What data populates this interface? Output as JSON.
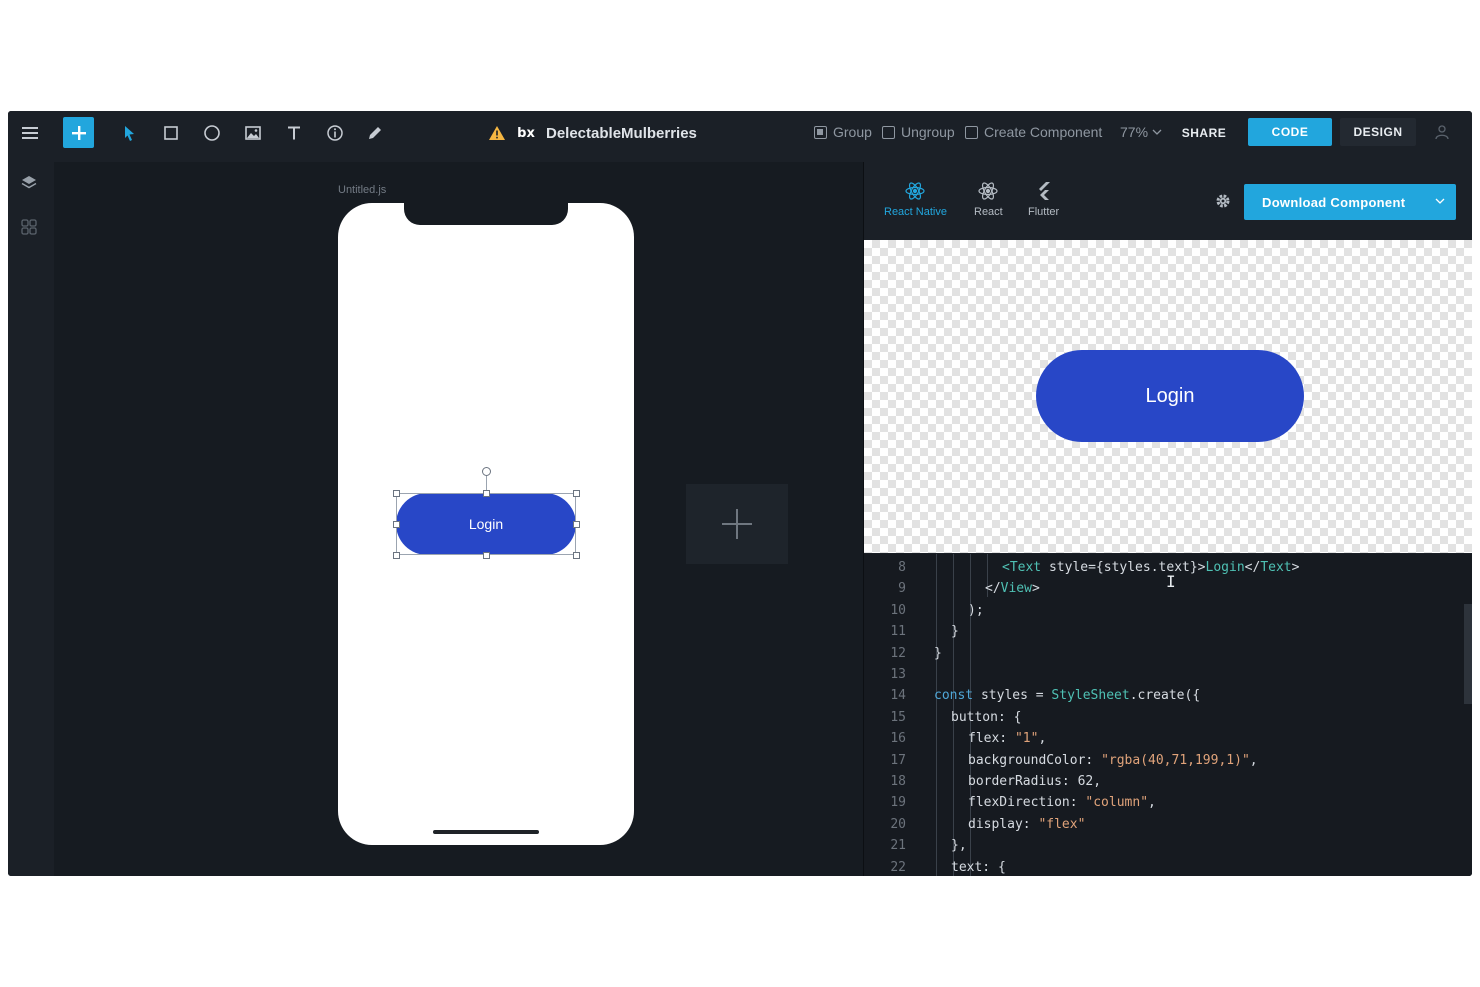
{
  "toolbar": {
    "title": "DelectableMulberries",
    "logo_text": "bx",
    "group_label": "Group",
    "ungroup_label": "Ungroup",
    "create_component_label": "Create Component",
    "zoom": "77%",
    "share_label": "SHARE",
    "code_label": "CODE",
    "design_label": "DESIGN"
  },
  "canvas": {
    "file_name": "Untitled.js",
    "button_label": "Login"
  },
  "panel": {
    "tabs": [
      {
        "label": "React Native",
        "active": true
      },
      {
        "label": "React",
        "active": false
      },
      {
        "label": "Flutter",
        "active": false
      }
    ],
    "download_label": "Download Component",
    "preview_button_label": "Login"
  },
  "code": {
    "lines": [
      {
        "n": "8",
        "indent": 4,
        "html": "<span class='tag'>&lt;Text</span> style={styles.text}&gt;<span class='tag'>Login</span>&lt;/<span class='tag'>Text</span>&gt;",
        "text": "<Text style={styles.text}>Login</Text>"
      },
      {
        "n": "9",
        "indent": 3,
        "html": "&lt;/<span class='tag'>View</span>&gt;",
        "text": "</View>"
      },
      {
        "n": "10",
        "indent": 2,
        "html": ");",
        "text": ");"
      },
      {
        "n": "11",
        "indent": 1,
        "html": "}",
        "text": "}"
      },
      {
        "n": "12",
        "indent": 0,
        "html": "}",
        "text": "}"
      },
      {
        "n": "13",
        "indent": 0,
        "html": "",
        "text": ""
      },
      {
        "n": "14",
        "indent": 0,
        "html": "<span class='kw'>const</span> styles = <span class='cls'>StyleSheet</span>.create({",
        "text": "const styles = StyleSheet.create({"
      },
      {
        "n": "15",
        "indent": 1,
        "html": "button: {",
        "text": "button: {"
      },
      {
        "n": "16",
        "indent": 2,
        "html": "flex: <span class='str'>\"1\"</span>,",
        "text": "flex: \"1\","
      },
      {
        "n": "17",
        "indent": 2,
        "html": "backgroundColor: <span class='str'>\"rgba(40,71,199,1)\"</span>,",
        "text": "backgroundColor: \"rgba(40,71,199,1)\","
      },
      {
        "n": "18",
        "indent": 2,
        "html": "borderRadius: 62,",
        "text": "borderRadius: 62,"
      },
      {
        "n": "19",
        "indent": 2,
        "html": "flexDirection: <span class='str'>\"column\"</span>,",
        "text": "flexDirection: \"column\","
      },
      {
        "n": "20",
        "indent": 2,
        "html": "display: <span class='str'>\"flex\"</span>",
        "text": "display: \"flex\""
      },
      {
        "n": "21",
        "indent": 1,
        "html": "},",
        "text": "},"
      },
      {
        "n": "22",
        "indent": 1,
        "html": "text: {",
        "text": "text: {"
      }
    ]
  },
  "colors": {
    "accent": "#22a6dd",
    "button": "#2847c7",
    "warning": "#f5b642"
  },
  "icons": [
    "menu-icon",
    "plus-icon",
    "pointer-icon",
    "rectangle-icon",
    "ellipse-icon",
    "image-icon",
    "text-icon",
    "info-icon",
    "pen-icon",
    "warning-icon",
    "layers-icon",
    "components-icon",
    "gear-icon",
    "user-icon",
    "chevron-down-icon"
  ]
}
